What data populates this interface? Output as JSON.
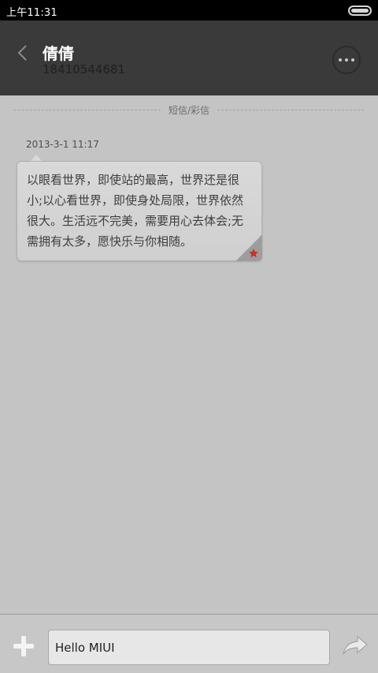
{
  "status_bar": {
    "time": "上午11:31"
  },
  "header": {
    "contact_name": "倩倩",
    "contact_number": "18410544681"
  },
  "thread": {
    "divider_label": "短信/彩信",
    "messages": [
      {
        "timestamp": "2013-3-1 11:17",
        "text": "以眼看世界，即使站的最高，世界还是很小;以心看世界，即使身处局限，世界依然很大。生活远不完美，需要用心去体会;无需拥有太多，愿快乐与你相随。",
        "starred": true
      }
    ]
  },
  "composer": {
    "input_value": "Hello MIUI"
  },
  "icons": {
    "back": "chevron-left-icon",
    "more": "more-dots-icon",
    "star": "star-icon",
    "add": "plus-icon",
    "send": "send-arrow-icon"
  },
  "colors": {
    "header_bg": "#3a3a3a",
    "body_bg": "#c4c4c4",
    "star": "#d62a1e"
  }
}
